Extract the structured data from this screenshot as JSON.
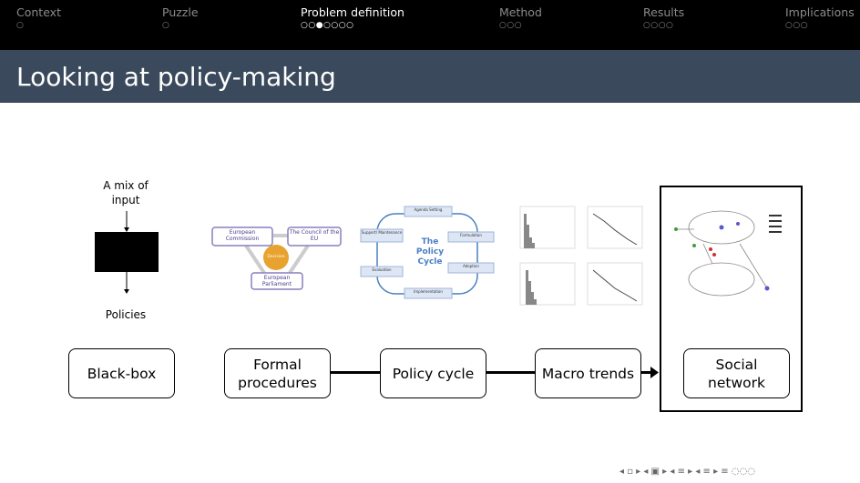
{
  "nav": {
    "sections": [
      {
        "label": "Context",
        "dots": "○"
      },
      {
        "label": "Puzzle",
        "dots": "○"
      },
      {
        "label": "Problem definition",
        "dots": "○○●○○○○"
      },
      {
        "label": "Method",
        "dots": "○○○"
      },
      {
        "label": "Results",
        "dots": "○○○○"
      },
      {
        "label": "Implications",
        "dots": "○○○"
      }
    ],
    "active_index": 2
  },
  "slide": {
    "title": "Looking at policy-making",
    "blackbox": {
      "input_label": "A mix of input",
      "output_label": "Policies"
    },
    "formal": {
      "commission": "European Commission",
      "council": "The Council of the EU",
      "decision": "Decision",
      "parliament": "European Parliament"
    },
    "cycle": {
      "center": "The Policy Cycle",
      "steps": [
        "Agenda Setting",
        "Formulation",
        "Adoption",
        "Implementation",
        "Evaluation",
        "Support/ Maintenance"
      ]
    },
    "boxes": {
      "blackbox": "Black-box",
      "formal_line1": "Formal",
      "formal_line2": "procedures",
      "cycle": "Policy cycle",
      "macro": "Macro trends",
      "social_line1": "Social",
      "social_line2": "network"
    }
  },
  "footer": {
    "nav_symbols": "◂ ▫ ▸ ◂ ▣ ▸ ◂ ≡ ▸ ◂ ≡ ▸   ≡   ◌◌◌"
  },
  "colors": {
    "nav_bg": "#000000",
    "title_bg": "#3a4a5c",
    "cycle_blue": "#4a7fc4",
    "formal_orange": "#e8a22f",
    "formal_purple": "#8a7fbf"
  }
}
